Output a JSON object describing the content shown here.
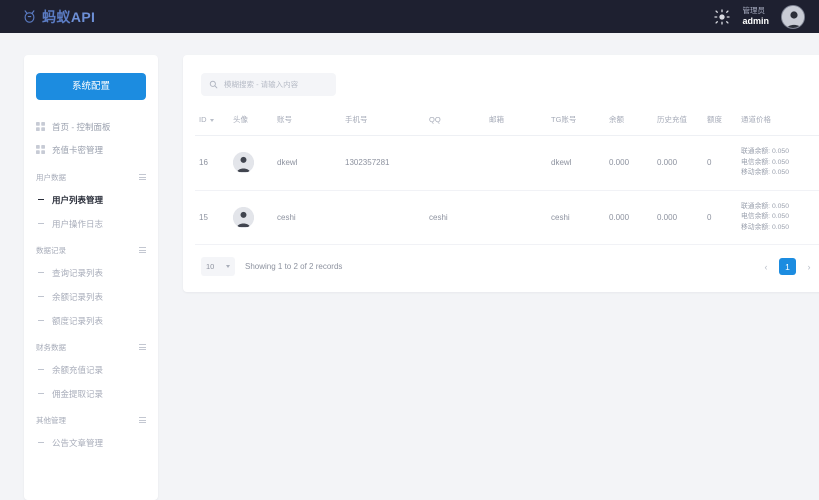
{
  "topbar": {
    "brand_name": "蚂蚁",
    "brand_suffix": "API",
    "theme_icon": "sun-icon",
    "user_role": "管理员",
    "user_name": "admin"
  },
  "sidebar": {
    "system_config_label": "系统配置",
    "top_items": [
      {
        "label": "首页 - 控制面板",
        "icon": "grid-icon"
      },
      {
        "label": "充值卡密管理",
        "icon": "grid-icon"
      }
    ],
    "groups": [
      {
        "title": "用户数据",
        "items": [
          {
            "label": "用户列表管理",
            "active": true
          },
          {
            "label": "用户操作日志",
            "active": false
          }
        ]
      },
      {
        "title": "数据记录",
        "items": [
          {
            "label": "查询记录列表",
            "active": false
          },
          {
            "label": "余额记录列表",
            "active": false
          },
          {
            "label": "额度记录列表",
            "active": false
          }
        ]
      },
      {
        "title": "财务数据",
        "items": [
          {
            "label": "余额充值记录",
            "active": false
          },
          {
            "label": "佣金提取记录",
            "active": false
          }
        ]
      },
      {
        "title": "其他管理",
        "items": [
          {
            "label": "公告文章管理",
            "active": false
          }
        ]
      }
    ]
  },
  "main": {
    "search": {
      "placeholder": "模糊搜索 - 请输入内容",
      "value": "",
      "icon": "search-icon"
    },
    "table": {
      "columns": [
        "ID",
        "头像",
        "账号",
        "手机号",
        "QQ",
        "邮箱",
        "TG账号",
        "余额",
        "历史充值",
        "额度",
        "通道价格"
      ],
      "rows": [
        {
          "id": "16",
          "avatar": "user-avatar",
          "account": "dkewl",
          "phone": "1302357281",
          "qq": "",
          "email": "",
          "tg": "dkewl",
          "balance": "0.000",
          "history_recharge": "0.000",
          "quota": "0",
          "prices": [
            "联通余额: 0.050",
            "电信余额: 0.050",
            "移动余额: 0.050"
          ]
        },
        {
          "id": "15",
          "avatar": "user-avatar",
          "account": "ceshi",
          "phone": "",
          "qq": "ceshi",
          "email": "",
          "tg": "ceshi",
          "balance": "0.000",
          "history_recharge": "0.000",
          "quota": "0",
          "prices": [
            "联通余额: 0.050",
            "电信余额: 0.050",
            "移动余额: 0.050"
          ]
        }
      ]
    },
    "footer": {
      "per_page": "10",
      "showing_text": "Showing 1 to 2 of 2 records",
      "prev_label": "‹",
      "next_label": "›",
      "current_page": "1"
    }
  },
  "colors": {
    "accent": "#1c8ce0",
    "topbar_bg": "#1e2030",
    "page_bg": "#f3f4f7",
    "card_bg": "#ffffff"
  }
}
